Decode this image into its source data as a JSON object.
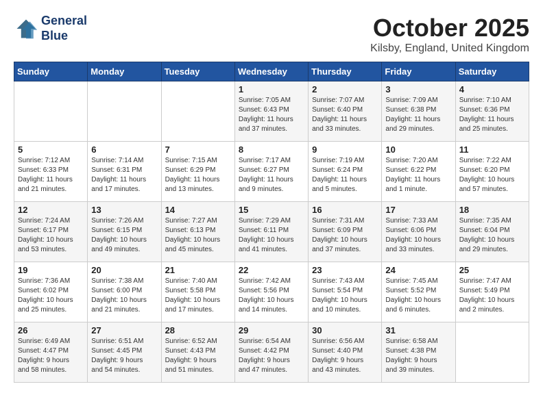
{
  "header": {
    "logo_line1": "General",
    "logo_line2": "Blue",
    "month_title": "October 2025",
    "location": "Kilsby, England, United Kingdom"
  },
  "days_of_week": [
    "Sunday",
    "Monday",
    "Tuesday",
    "Wednesday",
    "Thursday",
    "Friday",
    "Saturday"
  ],
  "weeks": [
    [
      {
        "day": "",
        "info": ""
      },
      {
        "day": "",
        "info": ""
      },
      {
        "day": "",
        "info": ""
      },
      {
        "day": "1",
        "info": "Sunrise: 7:05 AM\nSunset: 6:43 PM\nDaylight: 11 hours\nand 37 minutes."
      },
      {
        "day": "2",
        "info": "Sunrise: 7:07 AM\nSunset: 6:40 PM\nDaylight: 11 hours\nand 33 minutes."
      },
      {
        "day": "3",
        "info": "Sunrise: 7:09 AM\nSunset: 6:38 PM\nDaylight: 11 hours\nand 29 minutes."
      },
      {
        "day": "4",
        "info": "Sunrise: 7:10 AM\nSunset: 6:36 PM\nDaylight: 11 hours\nand 25 minutes."
      }
    ],
    [
      {
        "day": "5",
        "info": "Sunrise: 7:12 AM\nSunset: 6:33 PM\nDaylight: 11 hours\nand 21 minutes."
      },
      {
        "day": "6",
        "info": "Sunrise: 7:14 AM\nSunset: 6:31 PM\nDaylight: 11 hours\nand 17 minutes."
      },
      {
        "day": "7",
        "info": "Sunrise: 7:15 AM\nSunset: 6:29 PM\nDaylight: 11 hours\nand 13 minutes."
      },
      {
        "day": "8",
        "info": "Sunrise: 7:17 AM\nSunset: 6:27 PM\nDaylight: 11 hours\nand 9 minutes."
      },
      {
        "day": "9",
        "info": "Sunrise: 7:19 AM\nSunset: 6:24 PM\nDaylight: 11 hours\nand 5 minutes."
      },
      {
        "day": "10",
        "info": "Sunrise: 7:20 AM\nSunset: 6:22 PM\nDaylight: 11 hours\nand 1 minute."
      },
      {
        "day": "11",
        "info": "Sunrise: 7:22 AM\nSunset: 6:20 PM\nDaylight: 10 hours\nand 57 minutes."
      }
    ],
    [
      {
        "day": "12",
        "info": "Sunrise: 7:24 AM\nSunset: 6:17 PM\nDaylight: 10 hours\nand 53 minutes."
      },
      {
        "day": "13",
        "info": "Sunrise: 7:26 AM\nSunset: 6:15 PM\nDaylight: 10 hours\nand 49 minutes."
      },
      {
        "day": "14",
        "info": "Sunrise: 7:27 AM\nSunset: 6:13 PM\nDaylight: 10 hours\nand 45 minutes."
      },
      {
        "day": "15",
        "info": "Sunrise: 7:29 AM\nSunset: 6:11 PM\nDaylight: 10 hours\nand 41 minutes."
      },
      {
        "day": "16",
        "info": "Sunrise: 7:31 AM\nSunset: 6:09 PM\nDaylight: 10 hours\nand 37 minutes."
      },
      {
        "day": "17",
        "info": "Sunrise: 7:33 AM\nSunset: 6:06 PM\nDaylight: 10 hours\nand 33 minutes."
      },
      {
        "day": "18",
        "info": "Sunrise: 7:35 AM\nSunset: 6:04 PM\nDaylight: 10 hours\nand 29 minutes."
      }
    ],
    [
      {
        "day": "19",
        "info": "Sunrise: 7:36 AM\nSunset: 6:02 PM\nDaylight: 10 hours\nand 25 minutes."
      },
      {
        "day": "20",
        "info": "Sunrise: 7:38 AM\nSunset: 6:00 PM\nDaylight: 10 hours\nand 21 minutes."
      },
      {
        "day": "21",
        "info": "Sunrise: 7:40 AM\nSunset: 5:58 PM\nDaylight: 10 hours\nand 17 minutes."
      },
      {
        "day": "22",
        "info": "Sunrise: 7:42 AM\nSunset: 5:56 PM\nDaylight: 10 hours\nand 14 minutes."
      },
      {
        "day": "23",
        "info": "Sunrise: 7:43 AM\nSunset: 5:54 PM\nDaylight: 10 hours\nand 10 minutes."
      },
      {
        "day": "24",
        "info": "Sunrise: 7:45 AM\nSunset: 5:52 PM\nDaylight: 10 hours\nand 6 minutes."
      },
      {
        "day": "25",
        "info": "Sunrise: 7:47 AM\nSunset: 5:49 PM\nDaylight: 10 hours\nand 2 minutes."
      }
    ],
    [
      {
        "day": "26",
        "info": "Sunrise: 6:49 AM\nSunset: 4:47 PM\nDaylight: 9 hours\nand 58 minutes."
      },
      {
        "day": "27",
        "info": "Sunrise: 6:51 AM\nSunset: 4:45 PM\nDaylight: 9 hours\nand 54 minutes."
      },
      {
        "day": "28",
        "info": "Sunrise: 6:52 AM\nSunset: 4:43 PM\nDaylight: 9 hours\nand 51 minutes."
      },
      {
        "day": "29",
        "info": "Sunrise: 6:54 AM\nSunset: 4:42 PM\nDaylight: 9 hours\nand 47 minutes."
      },
      {
        "day": "30",
        "info": "Sunrise: 6:56 AM\nSunset: 4:40 PM\nDaylight: 9 hours\nand 43 minutes."
      },
      {
        "day": "31",
        "info": "Sunrise: 6:58 AM\nSunset: 4:38 PM\nDaylight: 9 hours\nand 39 minutes."
      },
      {
        "day": "",
        "info": ""
      }
    ]
  ]
}
